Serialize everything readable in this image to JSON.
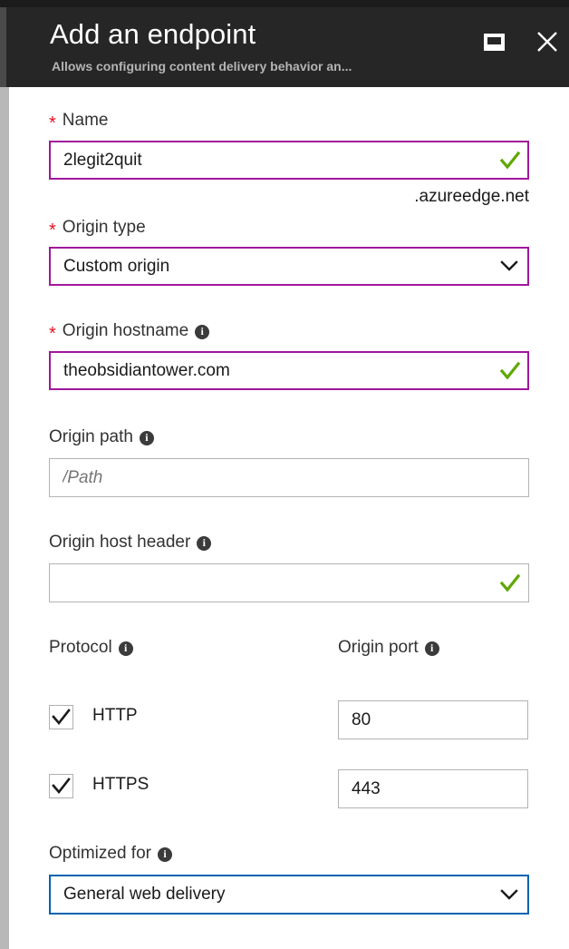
{
  "blade": {
    "title": "Add an endpoint",
    "subtitle": "Allows configuring content delivery behavior an...",
    "maximize_label": "Maximize",
    "close_label": "Close"
  },
  "form": {
    "name": {
      "label": "Name",
      "required_marker": "*",
      "value": "2legit2quit",
      "placeholder": "",
      "suffix": ".azureedge.net",
      "valid": true
    },
    "origin_type": {
      "label": "Origin type",
      "required_marker": "*",
      "value": "Custom origin"
    },
    "origin_hostname": {
      "label": "Origin hostname",
      "required_marker": "*",
      "value": "theobsidiantower.com",
      "placeholder": "",
      "valid": true
    },
    "origin_path": {
      "label": "Origin path",
      "value": "",
      "placeholder": "/Path"
    },
    "origin_host_header": {
      "label": "Origin host header",
      "value": "",
      "placeholder": "",
      "valid": true
    },
    "protocol": {
      "label": "Protocol",
      "http_label": "HTTP",
      "https_label": "HTTPS"
    },
    "origin_port": {
      "label": "Origin port",
      "http_port": "80",
      "https_port": "443"
    },
    "optimized_for": {
      "label": "Optimized for",
      "value": "General web delivery"
    }
  },
  "colors": {
    "header_bg": "#262626",
    "accent_purple": "#a0179b",
    "focus_blue": "#0063b1",
    "valid_green": "#5ea800",
    "required_red": "#e81123"
  }
}
